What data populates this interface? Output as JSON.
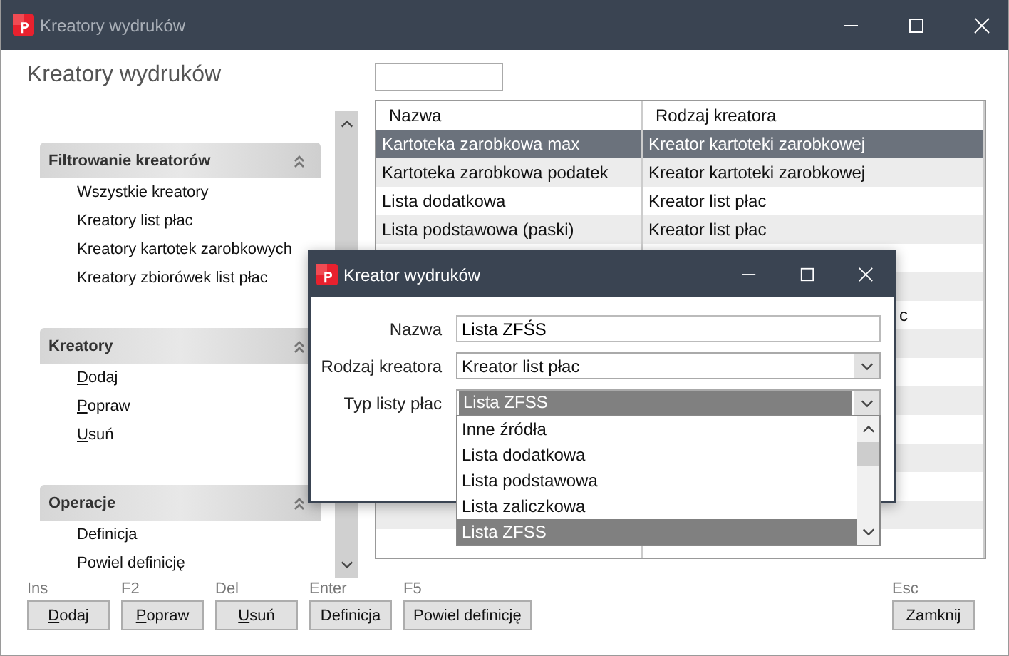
{
  "window": {
    "title": "Kreatory wydruków"
  },
  "heading": "Kreatory wydruków",
  "sidebar": {
    "groups": [
      {
        "title": "Filtrowanie kreatorów",
        "expanded": true,
        "items": [
          {
            "label": "Wszystkie kreatory",
            "underlined_key": false
          },
          {
            "label": "Kreatory list płac",
            "underlined_key": false
          },
          {
            "label": "Kreatory kartotek zarobkowych",
            "underlined_key": false
          },
          {
            "label": "Kreatory zbiorówek list płac",
            "underlined_key": false
          }
        ]
      },
      {
        "title": "Kreatory",
        "expanded": true,
        "items": [
          {
            "label": "Dodaj",
            "underlined_key": true
          },
          {
            "label": "Popraw",
            "underlined_key": true
          },
          {
            "label": "Usuń",
            "underlined_key": true
          }
        ]
      },
      {
        "title": "Operacje",
        "expanded": true,
        "items": [
          {
            "label": "Definicja",
            "underlined_key": false
          },
          {
            "label": "Powiel definicję",
            "underlined_key": false
          }
        ]
      }
    ]
  },
  "table": {
    "columns": [
      "Nazwa",
      "Rodzaj kreatora"
    ],
    "rows": [
      {
        "name": "Kartoteka zarobkowa max",
        "creator": "Kreator kartoteki zarobkowej",
        "selected": true
      },
      {
        "name": "Kartoteka zarobkowa podatek",
        "creator": "Kreator kartoteki zarobkowej",
        "selected": false
      },
      {
        "name": "Lista dodatkowa",
        "creator": "Kreator list płac",
        "selected": false
      },
      {
        "name": "Lista podstawowa (paski)",
        "creator": "Kreator list płac",
        "selected": false
      },
      {
        "selected": false
      },
      {
        "selected": false
      },
      {
        "creator_tail": "c",
        "selected": false
      }
    ]
  },
  "dialog": {
    "title": "Kreator wydruków",
    "name_field": {
      "label": "Nazwa",
      "value": "Lista ZFŚS"
    },
    "creator_field": {
      "label": "Rodzaj kreatora",
      "value": "Kreator list płac"
    },
    "type_field": {
      "label": "Typ listy płac",
      "value": "Lista ZFSS",
      "expanded": true,
      "options": [
        {
          "label": "Inne źródła",
          "selected": false
        },
        {
          "label": "Lista dodatkowa",
          "selected": false
        },
        {
          "label": "Lista podstawowa",
          "selected": false
        },
        {
          "label": "Lista zaliczkowa",
          "selected": false
        },
        {
          "label": "Lista ZFSS",
          "selected": true
        }
      ]
    }
  },
  "buttons": [
    {
      "key": "Ins",
      "label": "Dodaj",
      "underlined_key": true
    },
    {
      "key": "F2",
      "label": "Popraw",
      "underlined_key": true
    },
    {
      "key": "Del",
      "label": "Usuń",
      "underlined_key": true
    },
    {
      "key": "Enter",
      "label": "Definicja",
      "underlined_key": false
    },
    {
      "key": "F5",
      "label": "Powiel definicję",
      "underlined_key": false
    }
  ],
  "close_button": {
    "key": "Esc",
    "label": "Zamknij"
  }
}
